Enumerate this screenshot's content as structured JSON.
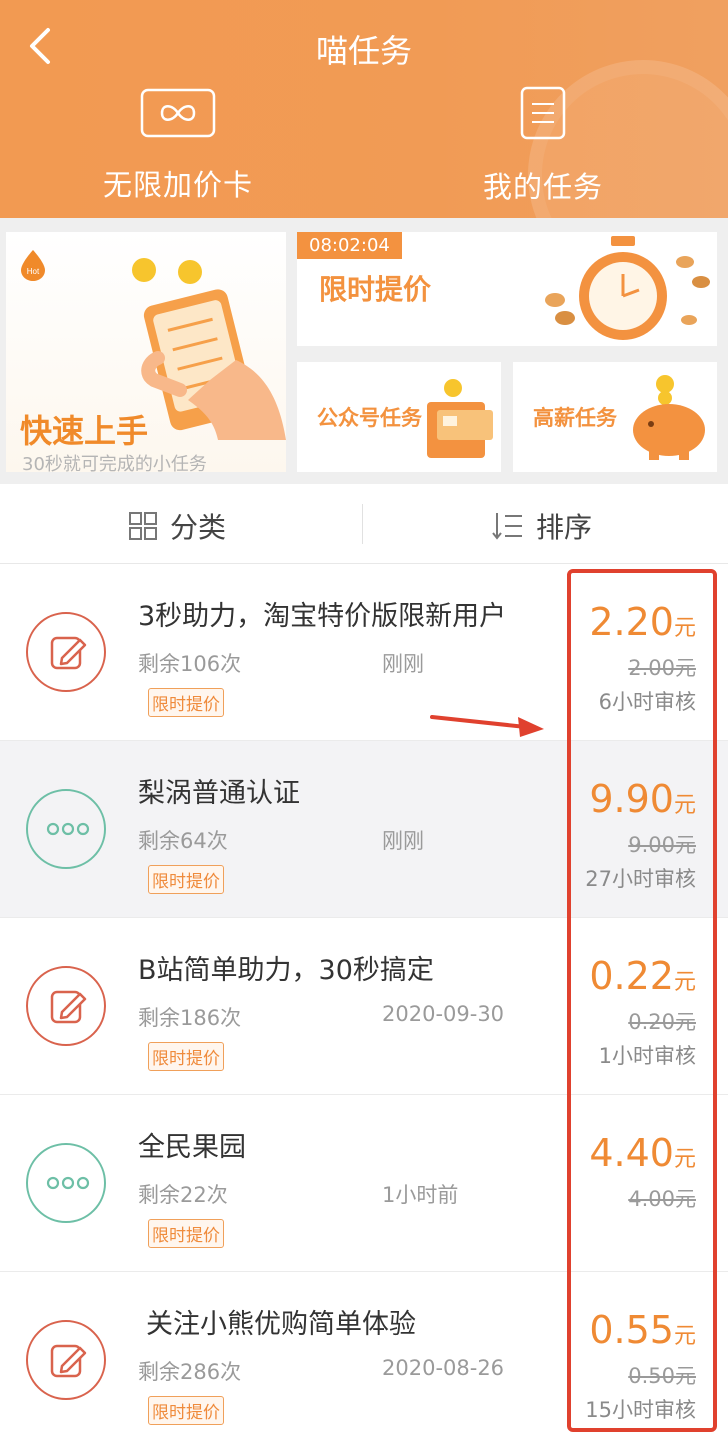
{
  "header": {
    "title": "喵任务",
    "buttons": [
      {
        "label": "无限加价卡",
        "icon": "infinity-card-icon"
      },
      {
        "label": "我的任务",
        "icon": "document-icon"
      }
    ]
  },
  "promo": {
    "quick_start": {
      "badge": "Hot",
      "title": "快速上手",
      "subtitle": "30秒就可完成的小任务"
    },
    "limited": {
      "timer": "08:02:04",
      "title": "限时提价"
    },
    "official_account": {
      "title": "公众号任务"
    },
    "high_pay": {
      "title": "高薪任务"
    }
  },
  "filter": {
    "category_label": "分类",
    "sort_label": "排序"
  },
  "colors": {
    "accent": "#ef8a34",
    "header": "#f29a52",
    "annotation": "#e0412e"
  },
  "tasks": [
    {
      "icon": "edit-icon",
      "name": "3秒助力，淘宝特价版限新用户",
      "remaining": "剩余106次",
      "time": "刚刚",
      "tag": "限时提价",
      "price": "2.20",
      "unit": "元",
      "old_price": "2.00元",
      "audit": "6小时审核"
    },
    {
      "icon": "more-icon",
      "name": "梨涡普通认证",
      "remaining": "剩余64次",
      "time": "刚刚",
      "tag": "限时提价",
      "price": "9.90",
      "unit": "元",
      "old_price": "9.00元",
      "audit": "27小时审核"
    },
    {
      "icon": "edit-icon",
      "name": "B站简单助力，30秒搞定",
      "remaining": "剩余186次",
      "time": "2020-09-30",
      "tag": "限时提价",
      "price": "0.22",
      "unit": "元",
      "old_price": "0.20元",
      "audit": "1小时审核"
    },
    {
      "icon": "more-icon",
      "name": "全民果园",
      "remaining": "剩余22次",
      "time": "1小时前",
      "tag": "限时提价",
      "price": "4.40",
      "unit": "元",
      "old_price": "4.00元",
      "audit": ""
    },
    {
      "icon": "edit-icon",
      "name": "关注小熊优购简单体验",
      "remaining": "剩余286次",
      "time": "2020-08-26",
      "tag": "限时提价",
      "price": "0.55",
      "unit": "元",
      "old_price": "0.50元",
      "audit": "15小时审核"
    }
  ]
}
